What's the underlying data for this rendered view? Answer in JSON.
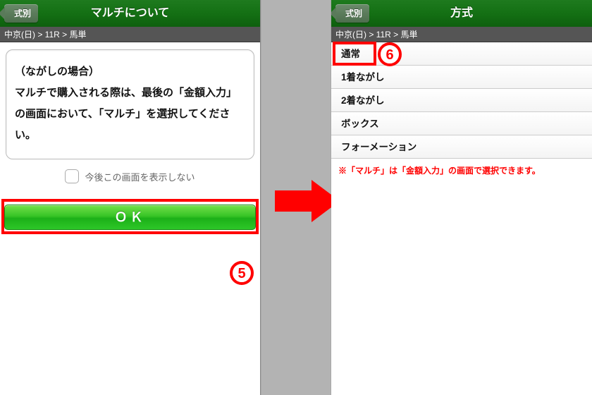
{
  "left": {
    "back_label": "式別",
    "title": "マルチについて",
    "breadcrumb": "中京(日) > 11R > 馬単",
    "message": "（ながしの場合）\nマルチで購入される際は、最後の「金額入力」の画面において、「マルチ」を選択してください。",
    "dont_show": "今後この画面を表示しない",
    "ok": "ＯＫ",
    "callout": "5"
  },
  "right": {
    "back_label": "式別",
    "title": "方式",
    "breadcrumb": "中京(日) > 11R > 馬単",
    "items": [
      "通常",
      "1着ながし",
      "2着ながし",
      "ボックス",
      "フォーメーション"
    ],
    "note": "※「マルチ」は「金額入力」の画面で選択できます。",
    "callout": "6"
  }
}
